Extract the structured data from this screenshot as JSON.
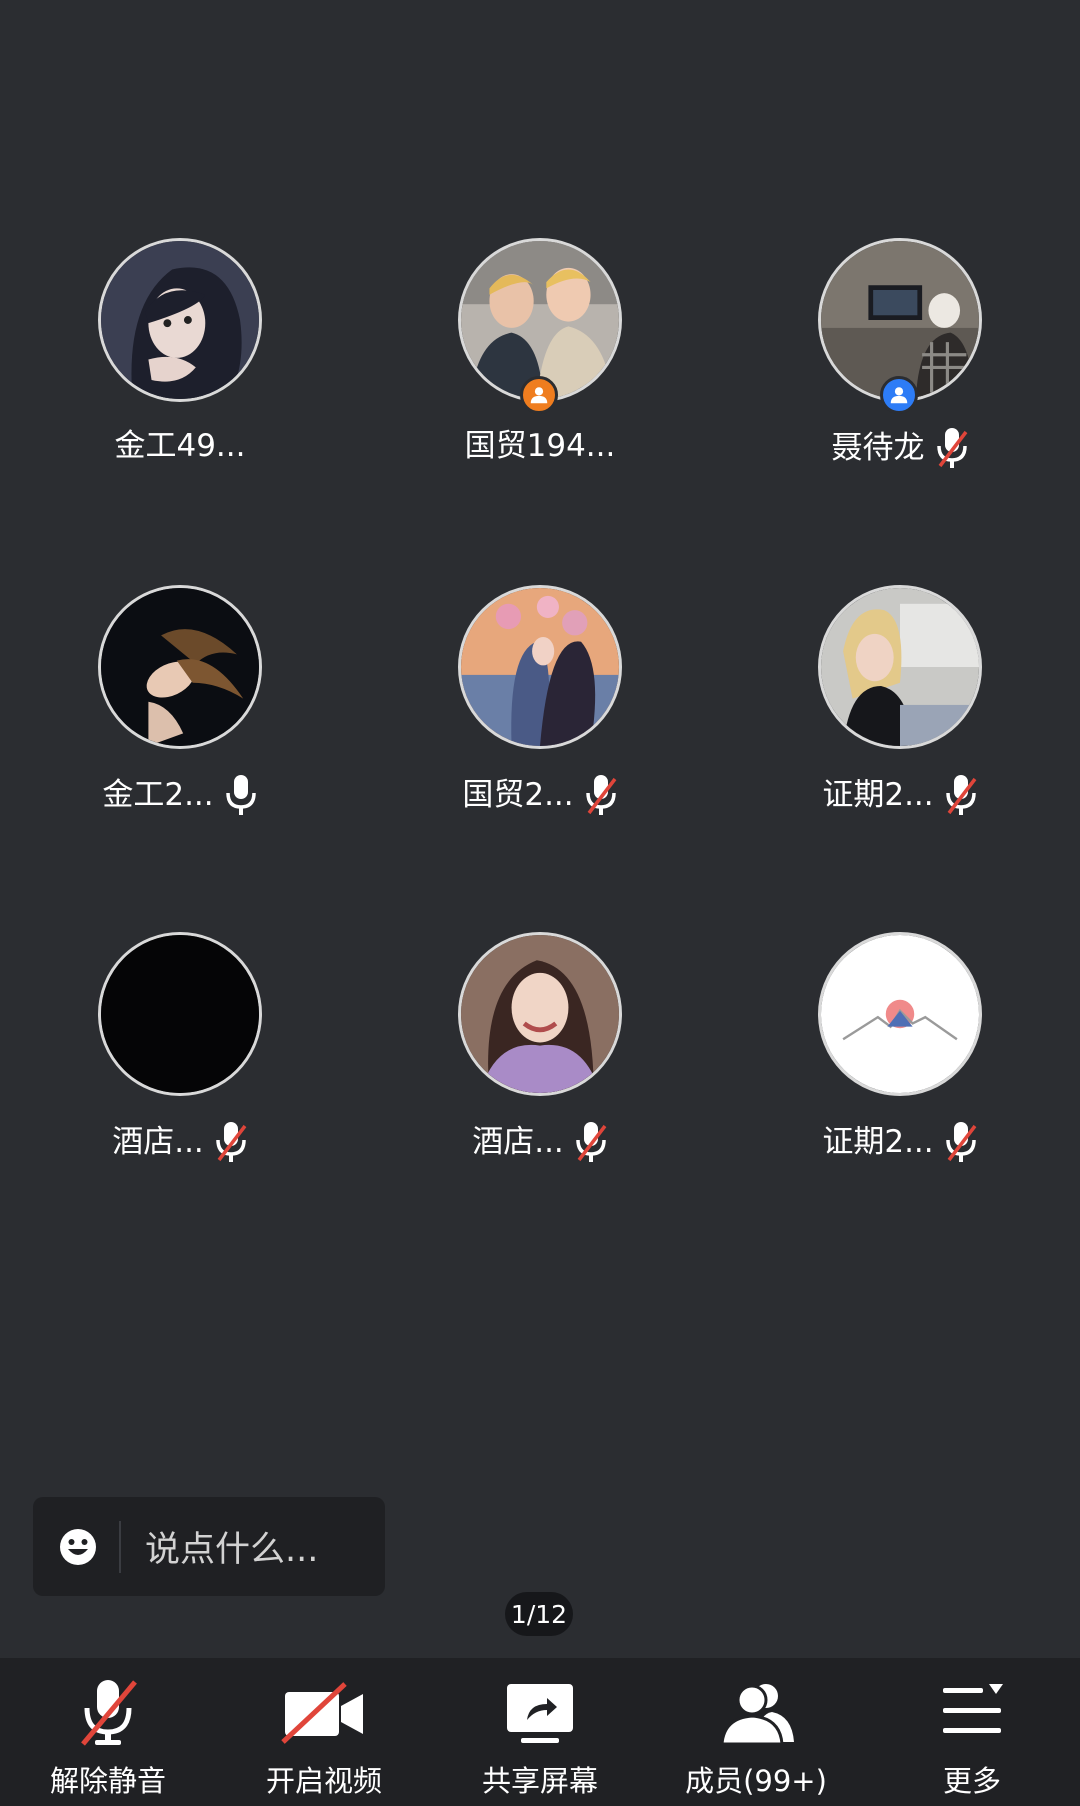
{
  "participants": [
    {
      "name": "金工49...",
      "mic": "none",
      "badge": null
    },
    {
      "name": "国贸194...",
      "mic": "none",
      "badge": "orange"
    },
    {
      "name": "聂待龙",
      "mic": "muted",
      "badge": "blue"
    },
    {
      "name": "金工2...",
      "mic": "on",
      "badge": null
    },
    {
      "name": "国贸2...",
      "mic": "muted",
      "badge": null
    },
    {
      "name": "证期2...",
      "mic": "muted",
      "badge": null
    },
    {
      "name": "酒店...",
      "mic": "muted",
      "badge": null
    },
    {
      "name": "酒店...",
      "mic": "muted",
      "badge": null
    },
    {
      "name": "证期2...",
      "mic": "muted",
      "badge": null
    }
  ],
  "chat": {
    "placeholder": "说点什么...",
    "icon": "emoji-icon"
  },
  "pager": {
    "text": "1/12"
  },
  "toolbar": {
    "unmute_label": "解除静音",
    "video_label": "开启视频",
    "share_label": "共享屏幕",
    "members_label": "成员(99+)",
    "more_label": "更多"
  },
  "colors": {
    "background": "#2b2d31",
    "toolbar": "#202124",
    "mute_slash": "#e0453a",
    "badge_orange": "#ef7d1f",
    "badge_blue": "#2d7cf6"
  }
}
